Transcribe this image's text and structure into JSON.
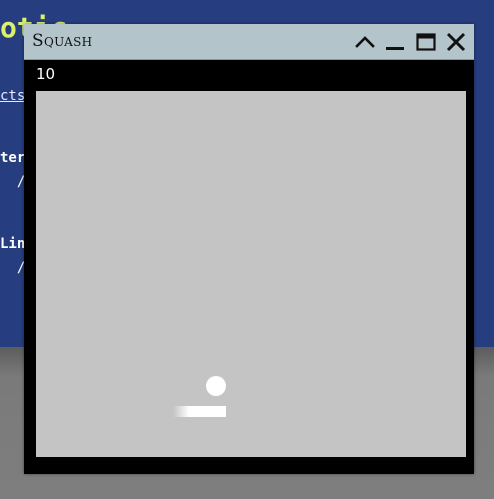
{
  "background": {
    "heading_fragment": "otic",
    "link_fragment": "cts",
    "line_a": "ter",
    "line_b": "  /",
    "line_c": "Lin",
    "line_d": "  /"
  },
  "window": {
    "title": "Squash",
    "buttons": {
      "rollup_icon": "chevron-up-icon",
      "minimize_icon": "minimize-icon",
      "maximize_icon": "maximize-icon",
      "close_icon": "close-icon"
    }
  },
  "game": {
    "score": "10",
    "colors": {
      "court": "#c4c4c4",
      "ball": "#ffffff",
      "paddle": "#ffffff",
      "frame": "#000000",
      "titlebar": "#b3c4cb"
    }
  }
}
